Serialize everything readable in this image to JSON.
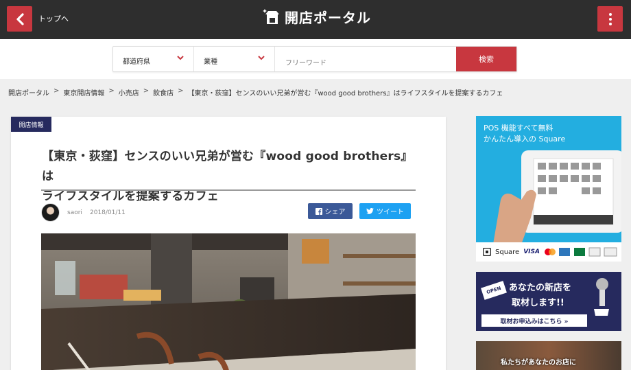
{
  "header": {
    "back_label": "トップへ",
    "logo_text": "開店ポータル"
  },
  "search": {
    "prefecture_label": "都道府県",
    "industry_label": "業種",
    "freeword_placeholder": "フリーワード",
    "submit_label": "検索"
  },
  "breadcrumb": [
    "開店ポータル",
    "東京開店情報",
    "小売店",
    "飲食店",
    "【東京・荻窪】センスのいい兄弟が営む『wood good brothers』はライフスタイルを提案するカフェ"
  ],
  "breadcrumb_sep": ">",
  "article": {
    "category": "開店情報",
    "title_line1": "【東京・荻窪】センスのいい兄弟が営む『wood good brothers』は",
    "title_line2": "ライフスタイルを提案するカフェ",
    "author": "saori",
    "date": "2018/01/11",
    "share_facebook": "シェア",
    "share_twitter": "ツイート"
  },
  "sidebar": {
    "ad1_line1": "POS 機能すべて無料",
    "ad1_line2": "かんたん導入の Square",
    "ad1_brand": "Square",
    "ad1_cards": "VISA",
    "ad2_sign": "OPEN",
    "ad2_line1": "あなたの新店を",
    "ad2_line2": "取材します!!",
    "ad2_cta": "取材お申込みはこちら »",
    "ad3_text": "私たちがあなたのお店に"
  },
  "colors": {
    "header_bg": "#2e2e2e",
    "accent_red": "#c8373f",
    "navy": "#262a5e",
    "facebook": "#3b5998",
    "twitter": "#1da1f2",
    "square_blue": "#23aee0"
  }
}
